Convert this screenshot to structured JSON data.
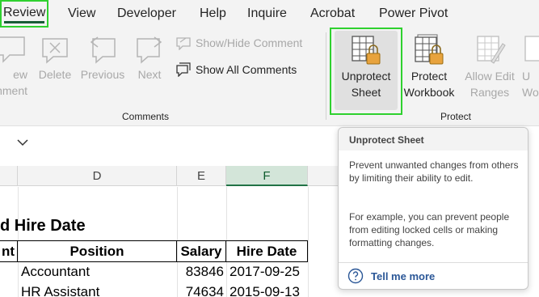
{
  "menu": {
    "tabs": [
      "Review",
      "View",
      "Developer",
      "Help",
      "Inquire",
      "Acrobat",
      "Power Pivot"
    ],
    "active": "Review"
  },
  "ribbon": {
    "comments_group": {
      "label": "Comments",
      "new_comment_partial_line1": "ew",
      "new_comment_partial_line2": "mment",
      "delete": "Delete",
      "previous": "Previous",
      "next": "Next",
      "show_hide": "Show/Hide Comment",
      "show_all": "Show All Comments"
    },
    "protect_group": {
      "label": "Protect",
      "unprotect_sheet_line1": "Unprotect",
      "unprotect_sheet_line2": "Sheet",
      "protect_workbook_line1": "Protect",
      "protect_workbook_line2": "Workbook",
      "allow_edit_line1": "Allow Edit",
      "allow_edit_line2": "Ranges",
      "unshare_partial_line1": "U",
      "unshare_partial_line2": "Wo"
    }
  },
  "columns": {
    "D": "D",
    "E": "E",
    "F": "F"
  },
  "sheet": {
    "title_partial": "d Hire Date",
    "headers": {
      "partial_prev": "nt",
      "position": "Position",
      "salary": "Salary",
      "hire_date": "Hire Date"
    },
    "rows": [
      {
        "position": "Accountant",
        "salary": "83846",
        "hire_date": "2017-09-25"
      },
      {
        "position": "HR Assistant",
        "salary": "74634",
        "hire_date": "2015-09-13"
      }
    ]
  },
  "tooltip": {
    "title": "Unprotect Sheet",
    "para1": "Prevent unwanted changes from others by limiting their ability to edit.",
    "para2": "For example, you can prevent people from editing locked cells or making formatting changes.",
    "link": "Tell me more"
  },
  "colors": {
    "highlight": "#2fd12f",
    "excel_green": "#217346",
    "link_blue": "#2b5797",
    "lock_gold": "#e8a33d"
  }
}
